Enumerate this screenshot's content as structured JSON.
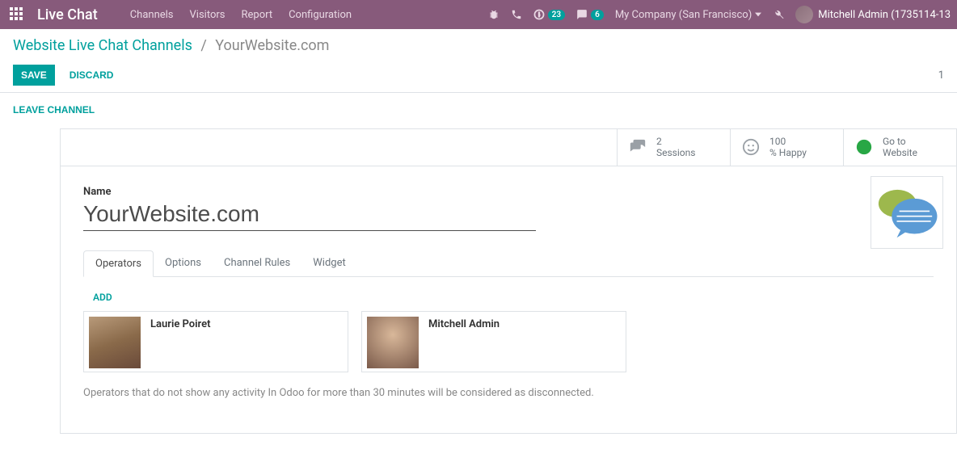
{
  "topbar": {
    "brand": "Live Chat",
    "nav": [
      "Channels",
      "Visitors",
      "Report",
      "Configuration"
    ],
    "badge_activity": "23",
    "badge_chat": "6",
    "company": "My Company (San Francisco)",
    "user": "Mitchell Admin (1735114-13"
  },
  "breadcrumb": {
    "root": "Website Live Chat Channels",
    "current": "YourWebsite.com"
  },
  "actions": {
    "save": "SAVE",
    "discard": "DISCARD",
    "page": "1",
    "leave": "LEAVE CHANNEL"
  },
  "stats": {
    "sessions_count": "2",
    "sessions_label": "Sessions",
    "happy_count": "100",
    "happy_label": "% Happy",
    "website_l1": "Go to",
    "website_l2": "Website"
  },
  "form": {
    "name_label": "Name",
    "name_value": "YourWebsite.com"
  },
  "tabs": [
    "Operators",
    "Options",
    "Channel Rules",
    "Widget"
  ],
  "operators_tab": {
    "add": "ADD",
    "operators": [
      {
        "name": "Laurie Poiret"
      },
      {
        "name": "Mitchell Admin"
      }
    ],
    "help": "Operators that do not show any activity In Odoo for more than 30 minutes will be considered as disconnected."
  }
}
